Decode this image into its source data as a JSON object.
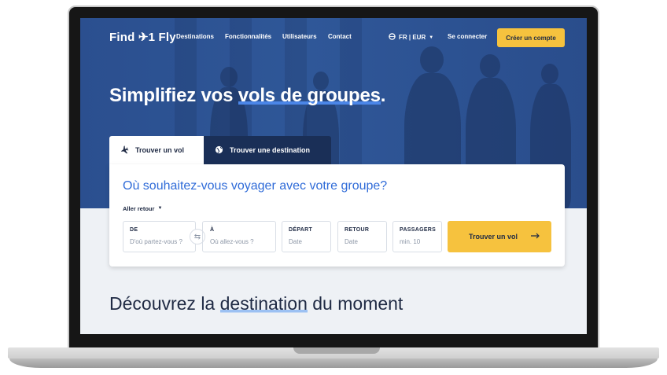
{
  "nav": {
    "logo": "Find ✈1 Fly",
    "links": [
      "Destinations",
      "Fonctionnalités",
      "Utilisateurs",
      "Contact"
    ],
    "lang": "FR | EUR",
    "login": "Se connecter",
    "cta": "Créer un compte"
  },
  "hero": {
    "headline_start": "Simplifiez vos ",
    "headline_highlight": "vols de groupes",
    "headline_end": "."
  },
  "tabs": [
    {
      "label": "Trouver un vol",
      "icon": "plane-icon",
      "active": true
    },
    {
      "label": "Trouver une destination",
      "icon": "globe-icon",
      "active": false
    }
  ],
  "search": {
    "question": "Où souhaitez-vous voyager avec votre groupe?",
    "trip_type": "Aller retour",
    "fields": [
      {
        "label": "DE",
        "placeholder": "D'où partez-vous ?"
      },
      {
        "label": "À",
        "placeholder": "Où allez-vous ?"
      },
      {
        "label": "DÉPART",
        "placeholder": "Date"
      },
      {
        "label": "RETOUR",
        "placeholder": "Date"
      },
      {
        "label": "PASSAGERS",
        "placeholder": "min. 10"
      }
    ],
    "button": "Trouver un vol"
  },
  "discover": {
    "start": "Découvrez la ",
    "highlight": "destination",
    "end": " du moment"
  },
  "colors": {
    "hero": "#2f5798",
    "accent": "#f6c23e",
    "link": "#2f6bd8",
    "tab_dark": "#1a2f57"
  }
}
